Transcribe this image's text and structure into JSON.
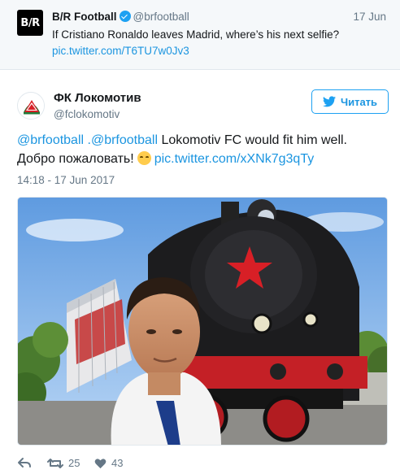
{
  "parent_tweet": {
    "name": "B/R Football",
    "avatar_text": "B/R",
    "handle": "@brfootball",
    "date": "17 Jun",
    "text": "If Cristiano Ronaldo leaves Madrid, where’s his next selfie?",
    "link": "pic.twitter.com/T6TU7w0Jv3"
  },
  "main_tweet": {
    "name": "ФК Локомотив",
    "handle": "@fclokomotiv",
    "follow_label": "Читать",
    "mention_1": "@brfootball",
    "mention_2": ".@brfootball",
    "text_body": " Lokomotiv FC would fit him well. Добро пожаловать!",
    "link": "pic.twitter.com/xXNk7g3qTy",
    "timestamp": "14:18 - 17 Jun 2017"
  },
  "actions": {
    "retweets": "25",
    "likes": "43"
  },
  "colors": {
    "link": "#1b95e0",
    "verified": "#1da1f2",
    "muted": "#657786",
    "loko_red": "#d81f26",
    "loko_green": "#1f7a3a"
  },
  "icons": {
    "verified": "verified-badge-icon",
    "follow": "twitter-bird-icon",
    "reply": "reply-icon",
    "retweet": "retweet-icon",
    "like": "heart-icon",
    "emoji": "smiling-face-emoji-icon"
  }
}
